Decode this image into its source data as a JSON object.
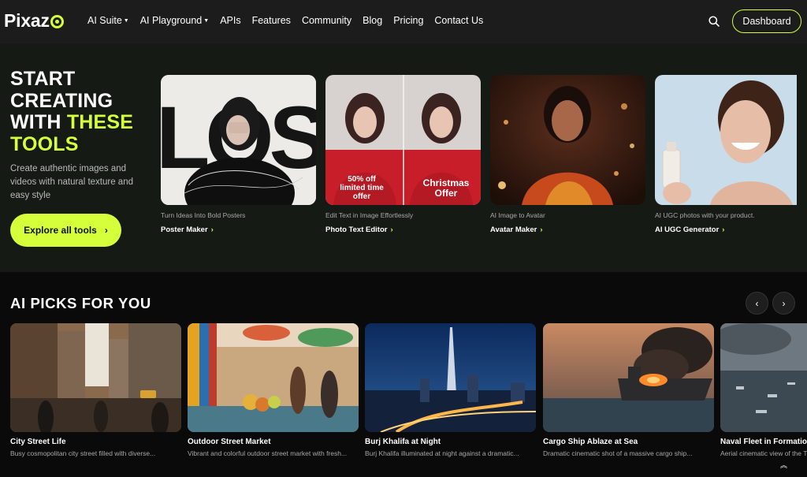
{
  "nav": {
    "logo": "Pixaz",
    "links": [
      {
        "label": "AI Suite",
        "caret": "▼"
      },
      {
        "label": "AI Playground",
        "caret": "▼"
      },
      {
        "label": "APIs",
        "caret": ""
      },
      {
        "label": "Features",
        "caret": ""
      },
      {
        "label": "Community",
        "caret": ""
      },
      {
        "label": "Blog",
        "caret": ""
      },
      {
        "label": "Pricing",
        "caret": ""
      },
      {
        "label": "Contact Us",
        "caret": ""
      }
    ],
    "dashboard_label": "Dashboard"
  },
  "hero": {
    "title_line1": "START",
    "title_line2": "CREATING",
    "title_line3a": "WITH ",
    "title_line3b": "THESE",
    "title_line4": "TOOLS",
    "description": "Create authentic images and videos with natural texture and easy style",
    "cta_label": "Explore all tools",
    "cta_arrow": "›"
  },
  "tools": [
    {
      "subtitle": "Turn Ideas Into Bold Posters",
      "label": "Poster Maker",
      "arrow": "›",
      "poster_text": "LOSE"
    },
    {
      "subtitle": "Edit Text in Image Effortlessly",
      "label": "Photo Text Editor",
      "arrow": "›",
      "overlay_left": "50% off limited time offer",
      "overlay_right": "Christmas Offer"
    },
    {
      "subtitle": "AI Image to Avatar",
      "label": "Avatar Maker",
      "arrow": "›"
    },
    {
      "subtitle": "AI UGC photos with your product.",
      "label": "AI UGC Generator",
      "arrow": "›"
    }
  ],
  "picks": {
    "title": "AI PICKS FOR YOU",
    "prev": "‹",
    "next": "›",
    "items": [
      {
        "title": "City Street Life",
        "desc": "Busy cosmopolitan city street filled with diverse..."
      },
      {
        "title": "Outdoor Street Market",
        "desc": "Vibrant and colorful outdoor street market with fresh..."
      },
      {
        "title": "Burj Khalifa at Night",
        "desc": "Burj Khalifa illuminated at night against a dramatic..."
      },
      {
        "title": "Cargo Ship Ablaze at Sea",
        "desc": "Dramatic cinematic shot of a massive cargo ship..."
      },
      {
        "title": "Naval Fleet in Formatio",
        "desc": "Aerial cinematic view of the T"
      }
    ]
  },
  "scroll_top": "︽",
  "colors": {
    "accent": "#d4ff3a",
    "nav_bg": "#1c1c1c",
    "hero_bg": "#161a15"
  }
}
